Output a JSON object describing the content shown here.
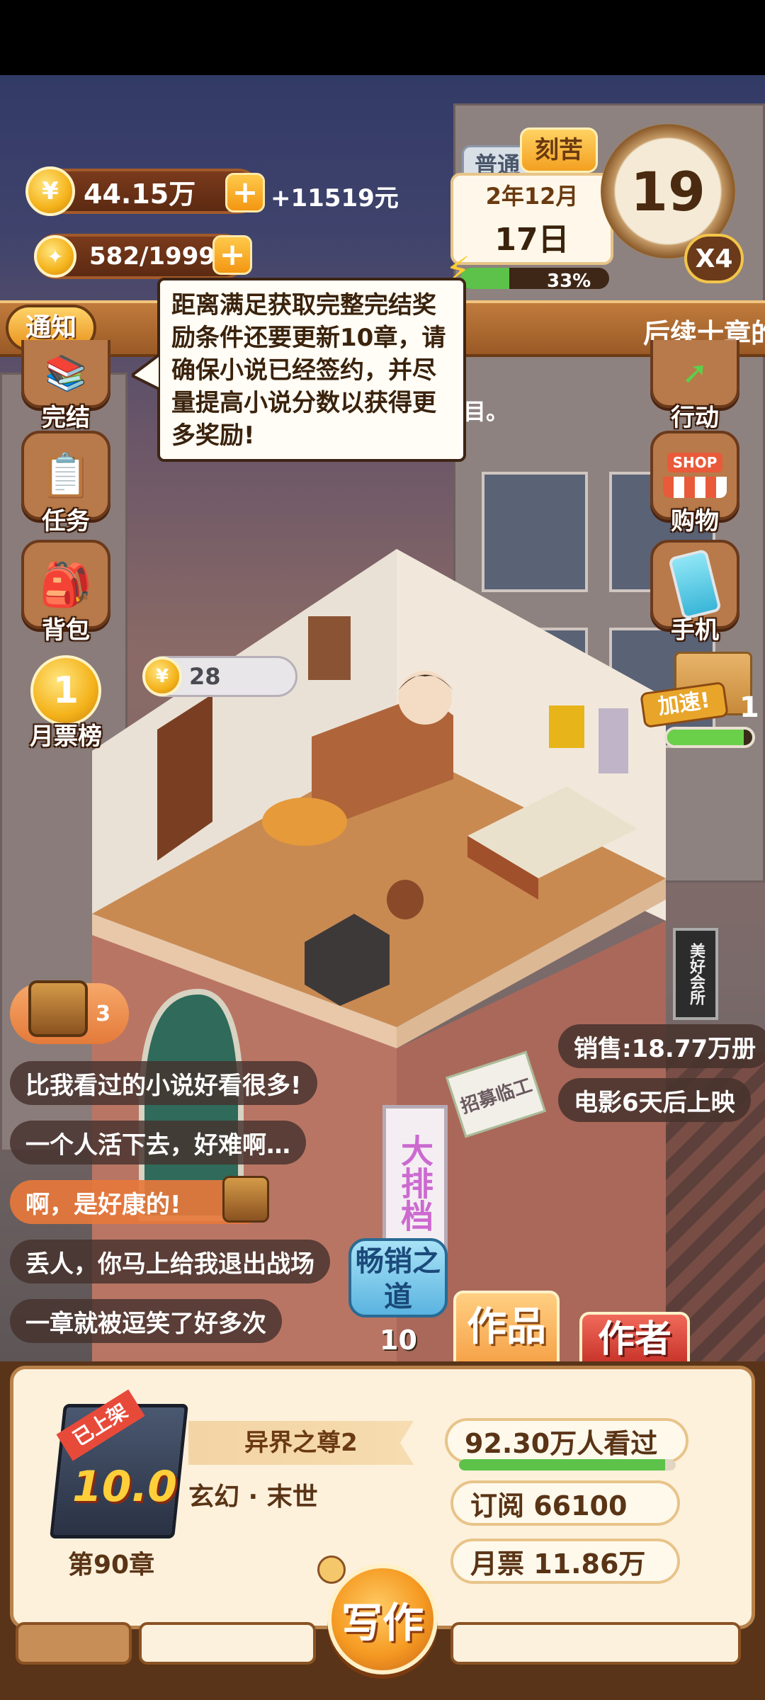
{
  "hud": {
    "coins": "44.15万",
    "income": "+11519元",
    "inspiration": "582/1999",
    "mode_normal": "普通",
    "mode_hard": "刻苦",
    "year_month": "2年12月",
    "day": "17日",
    "progress_percent": "33%",
    "progress_fraction": 0.33,
    "clock_number": "19",
    "multiplier": "X4"
  },
  "notice": {
    "label": "通知",
    "scroll_text": "后续十章的",
    "tooltip": "距离满足获取完整完结奖励条件还要更新10章，请确保小说已经签约，并尽量提高小说分数以获得更多奖励!",
    "hidden_tail": "目。"
  },
  "left_menu": [
    {
      "label": "完结"
    },
    {
      "label": "任务"
    },
    {
      "label": "背包"
    },
    {
      "label": "月票榜",
      "badge": "1"
    }
  ],
  "right_menu": [
    {
      "label": "行动"
    },
    {
      "label": "购物",
      "badge": "SHOP"
    },
    {
      "label": "手机"
    }
  ],
  "speedup": {
    "label": "加速!",
    "count": "1",
    "fill_fraction": 0.9
  },
  "room": {
    "coin_bubble": "28"
  },
  "chest": {
    "count": "3"
  },
  "comments": [
    "比我看过的小说好看很多!",
    "一个人活下去，好难啊…",
    "啊，是好康的!",
    "丢人，你马上给我退出战场",
    "一章就被逗笑了好多次"
  ],
  "info_pills": {
    "sales": "销售:18.77万册",
    "movie": "电影6天后上映"
  },
  "signs": {
    "recruit": "招募临工",
    "big_sign": "大排档",
    "street_sign": "美好会所"
  },
  "bestseller": {
    "label": "畅销之道",
    "count": "10"
  },
  "tabs": {
    "works": "作品",
    "author": "作者"
  },
  "book": {
    "badge": "已上架",
    "score": "10.0",
    "title": "异界之尊2",
    "genre": "玄幻 · 末世",
    "chapter": "第90章",
    "views": "92.30万人看过",
    "views_fill": 0.95,
    "subscriptions": "订阅 66100",
    "monthly_votes": "月票 11.86万"
  },
  "write_button": "写作",
  "colors": {
    "accent": "#f39612",
    "panel": "#fdf1dc",
    "wood": "#b87a4a"
  }
}
